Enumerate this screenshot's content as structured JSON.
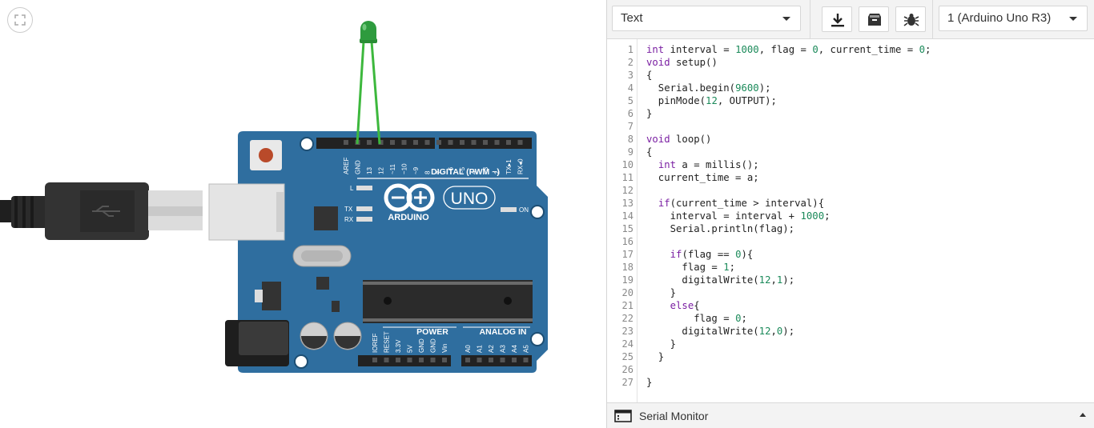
{
  "toolbar": {
    "mode_select": "Text",
    "device_select": "1 (Arduino Uno R3)",
    "buttons": [
      "download-icon",
      "library-icon",
      "debugger-icon"
    ]
  },
  "board": {
    "logo_text": "ARDUINO",
    "model_text": "UNO",
    "digital_label": "DIGITAL (PWM ~)",
    "power_label": "POWER",
    "analog_label": "ANALOG IN",
    "on_label": "ON",
    "l_label": "L",
    "tx_label": "TX",
    "rx_label": "RX",
    "top_pins": [
      "AREF",
      "GND",
      "13",
      "12",
      "~11",
      "~10",
      "~9",
      "8",
      "7",
      "~6",
      "~5",
      "4",
      "~3",
      "2",
      "TX▸1",
      "RX◂0"
    ],
    "power_pins": [
      "IOREF",
      "RESET",
      "3.3V",
      "5V",
      "GND",
      "GND",
      "Vin"
    ],
    "analog_pins": [
      "A0",
      "A1",
      "A2",
      "A3",
      "A4",
      "A5"
    ]
  },
  "led": {
    "color": "#2e9b3e"
  },
  "code": {
    "line_numbers": [
      "1",
      "2",
      "3",
      "4",
      "5",
      "6",
      "7",
      "8",
      "9",
      "10",
      "11",
      "12",
      "13",
      "14",
      "15",
      "16",
      "17",
      "18",
      "19",
      "20",
      "21",
      "22",
      "23",
      "24",
      "25",
      "26",
      "27"
    ],
    "lines": [
      "int interval = 1000, flag = 0, current_time = 0;",
      "void setup()",
      "{",
      "  Serial.begin(9600);",
      "  pinMode(12, OUTPUT);",
      "}",
      "",
      "void loop()",
      "{",
      "  int a = millis();",
      "  current_time = a;",
      "",
      "  if(current_time > interval){",
      "    interval = interval + 1000;",
      "    Serial.println(flag);",
      "",
      "    if(flag == 0){",
      "      flag = 1;",
      "      digitalWrite(12,1);",
      "    }",
      "    else{",
      "        flag = 0;",
      "      digitalWrite(12,0);",
      "    }",
      "  }",
      "",
      "}"
    ]
  },
  "serial_monitor": {
    "label": "Serial Monitor"
  },
  "colors": {
    "board": "#2f6e9f",
    "keyword": "#7a1fa2",
    "number": "#1b8a5a",
    "wire": "#3db83d"
  }
}
